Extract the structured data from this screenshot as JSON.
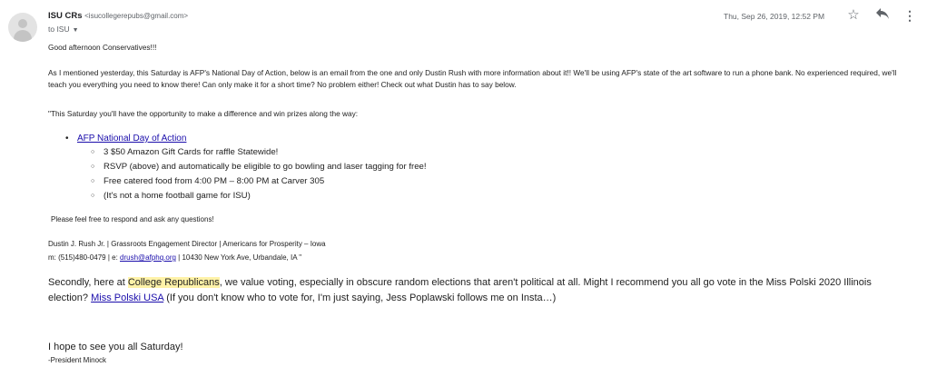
{
  "header": {
    "sender_name": "ISU CRs",
    "sender_email": "<isucollegerepubs@gmail.com>",
    "to_line": "to ISU",
    "date": "Thu, Sep 26, 2019, 12:52 PM",
    "icons": [
      "avatar",
      "star-icon",
      "reply-icon",
      "more-vert-icon"
    ]
  },
  "body": {
    "greeting": "Good afternoon Conservatives!!!",
    "para1": "As I mentioned yesterday, this Saturday is AFP's National Day of Action, below is an email from the one and only Dustin Rush with more information about it!! We'll be using AFP's state of the art software to run a phone bank. No experienced required, we'll teach you everything you need to know there! Can only make it for a short time? No problem either! Check out what Dustin has to say below.",
    "quote_intro": "\"This Saturday you'll have the opportunity to make a difference and win prizes along the way:",
    "bullet_link": "AFP National Day of Action",
    "sub_bullets": [
      "3 $50 Amazon Gift Cards for raffle Statewide!",
      "RSVP (above) and automatically be eligible to go bowling and laser tagging for free!",
      "Free catered food from 4:00 PM – 8:00 PM at Carver 305",
      "(It's not a home football game for ISU)"
    ],
    "respond": "Please feel free to respond and ask any questions!",
    "sig_line1": "Dustin J. Rush Jr. | Grassroots Engagement Director | Americans for Prosperity – Iowa",
    "sig_line2_prefix": "m:  (515)480-0479  |  e:  ",
    "sig_email": "drush@afphq.org",
    "sig_line2_suffix": " | 10430 New York Ave, Urbandale, IA \"",
    "second_para": {
      "part1": "Secondly, here at ",
      "highlight": "College Republicans",
      "part2": ", we value voting, especially in obscure random elections that aren't political at all. Might I recommend you all go vote in the Miss Polski 2020 Illinois election? ",
      "link": "Miss Polski USA",
      "part3": " (If you don't know who to vote for, I'm just saying, Jess Poplawski follows me on Insta…)"
    },
    "closing": "I hope to see you all Saturday!",
    "signature": "-President Minock"
  }
}
